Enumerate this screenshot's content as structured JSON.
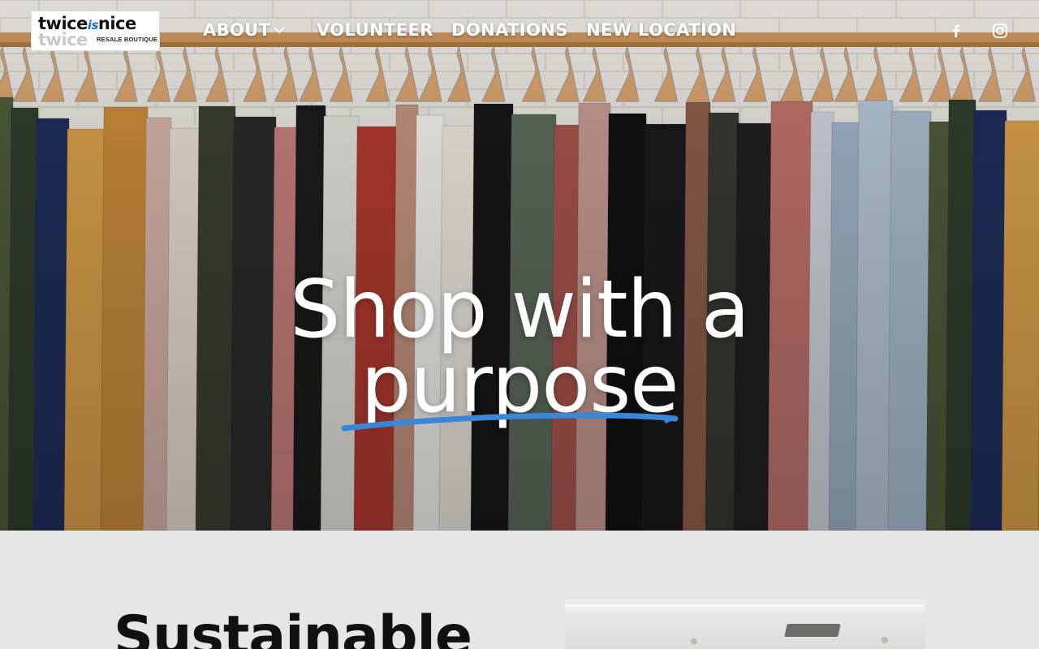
{
  "brand": {
    "logo_top": "twice",
    "logo_is": "is",
    "logo_top_rest": "nice",
    "logo_bottom": "twice",
    "logo_tag": "RESALE BOUTIQUE"
  },
  "nav": {
    "items": [
      {
        "label": "ABOUT",
        "has_dropdown": true
      },
      {
        "label": "VOLUNTEER"
      },
      {
        "label": "DONATIONS"
      },
      {
        "label": "NEW LOCATION"
      }
    ],
    "social": [
      {
        "icon": "facebook-icon"
      },
      {
        "icon": "instagram-icon"
      }
    ]
  },
  "hero": {
    "line1": "Shop with a",
    "line2": "purpose",
    "underline_color": "#3a86d8"
  },
  "section": {
    "title": "Sustainable"
  },
  "colors": {
    "accent": "#3a86d8",
    "nav_text": "#ffffff",
    "page_bg": "#e6e6e6"
  }
}
